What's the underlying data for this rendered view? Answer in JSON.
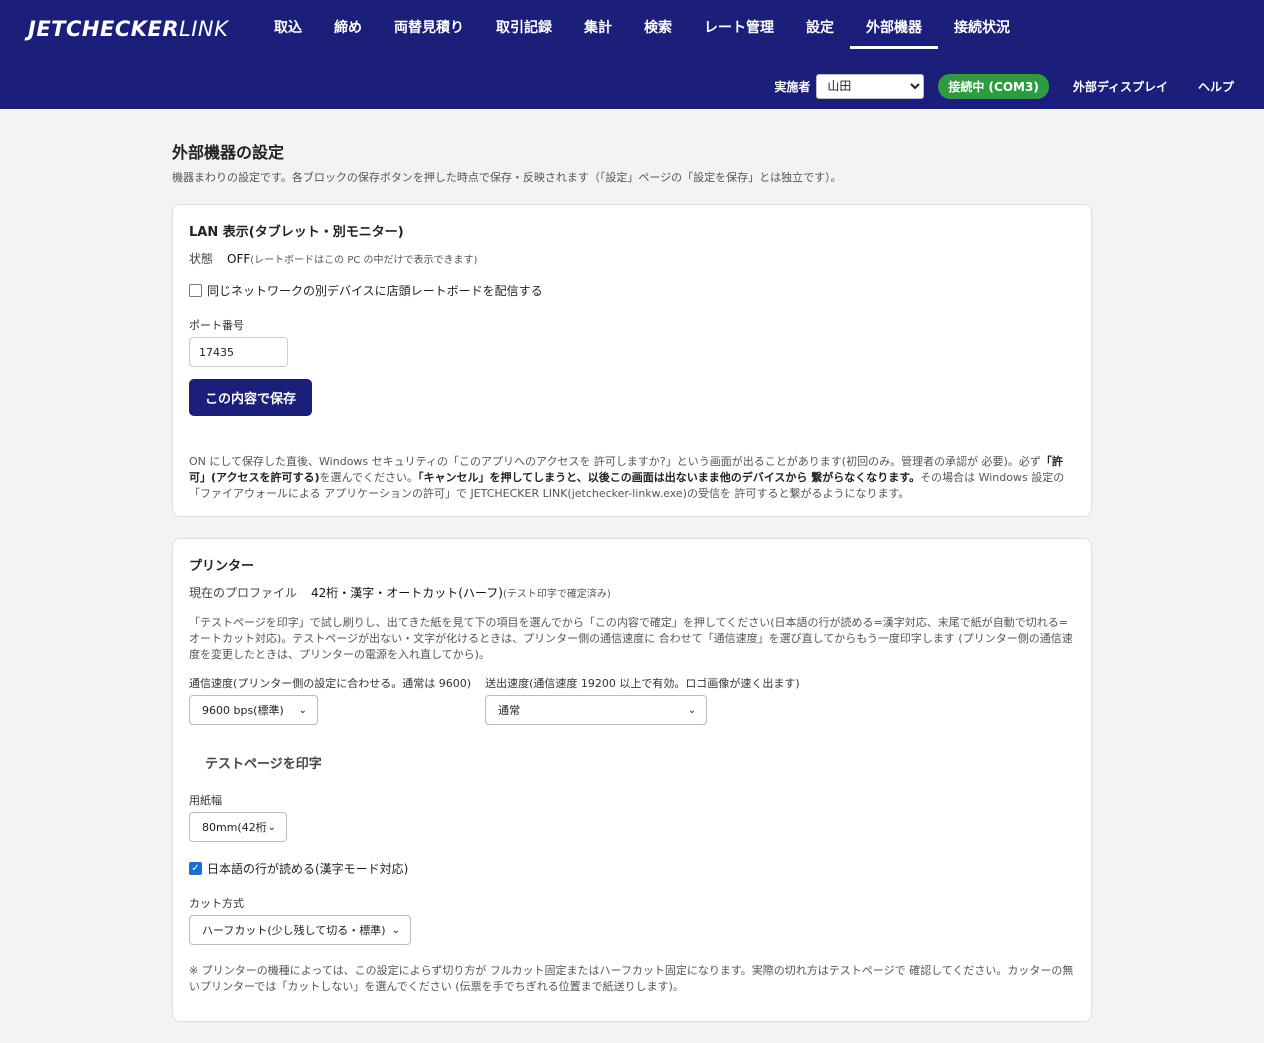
{
  "header": {
    "logo_bold": "JETCHECKER",
    "logo_light": "LINK",
    "nav": [
      "取込",
      "締め",
      "両替見積り",
      "取引記録",
      "集計",
      "検索",
      "レート管理",
      "設定",
      "外部機器",
      "接続状況"
    ],
    "active_nav": "外部機器",
    "operator_label": "実施者",
    "operator_value": "山田",
    "connection_status": "接続中 (COM3)",
    "external_display": "外部ディスプレイ",
    "help": "ヘルプ"
  },
  "page": {
    "title": "外部機器の設定",
    "description": "機器まわりの設定です。各ブロックの保存ボタンを押した時点で保存・反映されます（「設定」ページの「設定を保存」とは独立です）。"
  },
  "lan": {
    "title": "LAN 表示(タブレット・別モニター)",
    "status_key": "状態",
    "status_value": "OFF",
    "status_note": "(レートボードはこの PC の中だけで表示できます)",
    "checkbox_label": "同じネットワークの別デバイスに店頭レートボードを配信する",
    "port_label": "ポート番号",
    "port_value": "17435",
    "save_button": "この内容で保存",
    "note_1": "ON にして保存した直後、Windows セキュリティの「このアプリへのアクセスを 許可しますか?」という画面が出ることがあります(初回のみ。管理者の承認が 必要)。必ず",
    "note_bold_1": "「許可」(アクセスを許可する)",
    "note_2": "を選んでください。",
    "note_bold_2": "「キャンセル」を押してしまうと、以後この画面は出ないまま他のデバイスから 繋がらなくなります。",
    "note_3": "その場合は Windows 設定の「ファイアウォールによる アプリケーションの許可」で JETCHECKER LINK(jetchecker-linkw.exe)の受信を 許可すると繋がるようになります。"
  },
  "printer": {
    "title": "プリンター",
    "profile_key": "現在のプロファイル",
    "profile_value": "42桁・漢字・オートカット(ハーフ)",
    "profile_note": "(テスト印字で確定済み)",
    "description": "「テストページを印字」で試し刷りし、出てきた紙を見て下の項目を選んでから「この内容で確定」を押してください(日本語の行が読める=漢字対応、末尾で紙が自動で切れる=オートカット対応)。テストページが出ない・文字が化けるときは、プリンター側の通信速度に 合わせて「通信速度」を選び直してからもう一度印字します (プリンター側の通信速度を変更したときは、プリンターの電源を入れ直してから)。",
    "baud_label": "通信速度(プリンター側の設定に合わせる。通常は 9600)",
    "baud_value": "9600 bps(標準)",
    "send_label": "送出速度(通信速度 19200 以上で有効。ロゴ画像が速く出ます)",
    "send_value": "通常",
    "test_button": "テストページを印字",
    "paper_label": "用紙幅",
    "paper_value": "80mm(42桁",
    "kanji_label": "日本語の行が読める(漢字モード対応)",
    "cut_label": "カット方式",
    "cut_value": "ハーフカット(少し残して切る・標準)",
    "footnote": "※ プリンターの機種によっては、この設定によらず切り方が フルカット固定またはハーフカット固定になります。実際の切れ方はテストページで 確認してください。カッターの無いプリンターでは「カットしない」を選んでください (伝票を手でちぎれる位置まで紙送りします)。"
  }
}
